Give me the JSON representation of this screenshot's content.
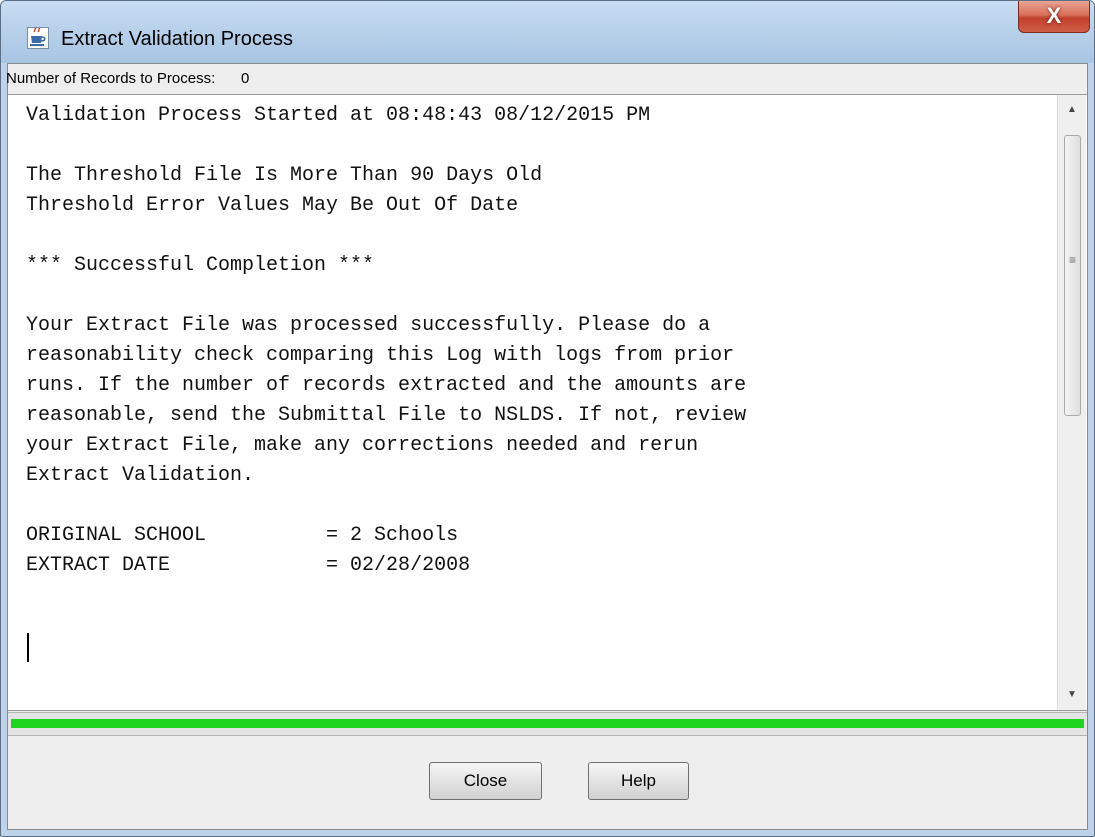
{
  "window": {
    "title": "Extract Validation Process",
    "close_glyph": "X"
  },
  "records": {
    "label": "Number of Records to Process:",
    "value": "0"
  },
  "log": {
    "lines": [
      "Validation Process Started at 08:48:43 08/12/2015 PM",
      "",
      "The Threshold File Is More Than 90 Days Old",
      "Threshold Error Values May Be Out Of Date",
      "",
      "*** Successful Completion ***",
      "",
      "Your Extract File was processed successfully. Please do a",
      "reasonability check comparing this Log with logs from prior",
      "runs. If the number of records extracted and the amounts are",
      "reasonable, send the Submittal File to NSLDS. If not, review",
      "your Extract File, make any corrections needed and rerun",
      "Extract Validation.",
      "",
      "ORIGINAL SCHOOL          = 2 Schools",
      "EXTRACT DATE             = 02/28/2008"
    ]
  },
  "progress": {
    "fraction": 1.0,
    "color": "#1fd41f"
  },
  "buttons": {
    "close": "Close",
    "help": "Help"
  },
  "icons": {
    "app": "java-coffee-cup-icon",
    "window_close": "close-icon",
    "scroll_up": "scroll-up-arrow-icon",
    "scroll_down": "scroll-down-arrow-icon",
    "scroll_grip": "scroll-grip-icon"
  },
  "colors": {
    "close_button": "#c1402a",
    "titlebar": "#b7d0ea"
  }
}
